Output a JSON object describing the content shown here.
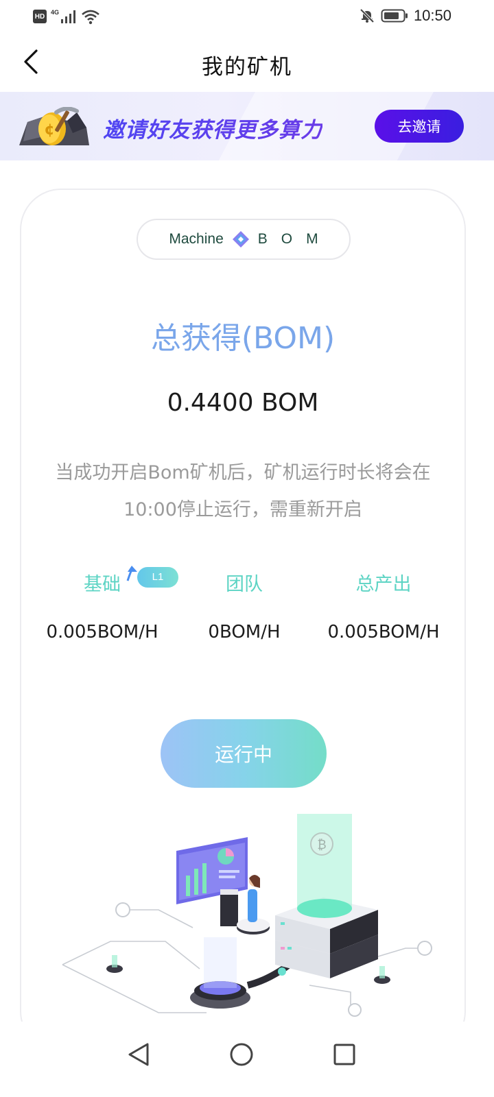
{
  "status_bar": {
    "hd": "HD",
    "network": "4G",
    "time": "10:50"
  },
  "header": {
    "title": "我的矿机",
    "back_icon": "chevron-left-icon"
  },
  "banner": {
    "text": "邀请好友获得更多算力",
    "button_label": "去邀请"
  },
  "card": {
    "machine_label": "Machine",
    "machine_letters": "BOM",
    "total_title": "总获得(BOM)",
    "total_value": "0.4400 BOM",
    "description": "当成功开启Bom矿机后，矿机运行时长将会在10:00停止运行，需重新开启",
    "stats": [
      {
        "label": "基础",
        "value": "0.005BOM/H",
        "badge": "L1"
      },
      {
        "label": "团队",
        "value": "0BOM/H"
      },
      {
        "label": "总产出",
        "value": "0.005BOM/H"
      }
    ],
    "run_button_label": "运行中"
  },
  "colors": {
    "accent_blue": "#7aa6ea",
    "accent_teal": "#5dd4c4",
    "banner_purple": "#5a10e8"
  }
}
